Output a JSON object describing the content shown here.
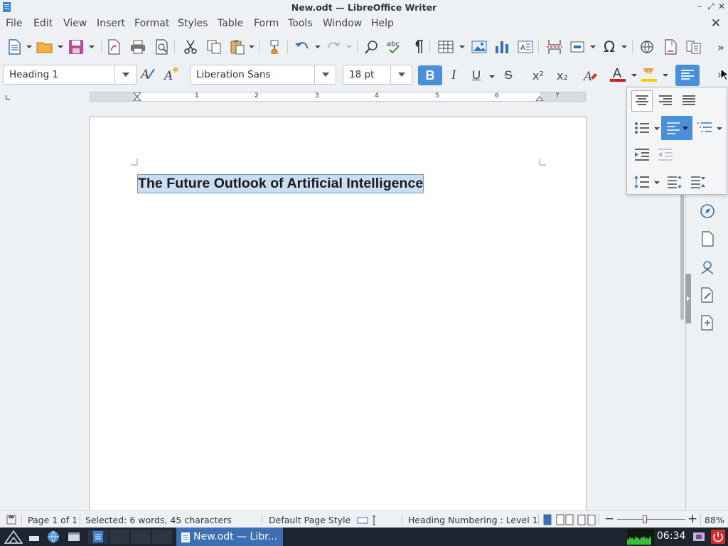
{
  "window": {
    "title": "New.odt — LibreOffice Writer",
    "minimize": "–",
    "maximize": "⤢",
    "close": "✕"
  },
  "menubar": {
    "items": [
      "File",
      "Edit",
      "View",
      "Insert",
      "Format",
      "Styles",
      "Table",
      "Form",
      "Tools",
      "Window",
      "Help"
    ],
    "close": "✕"
  },
  "toolbar": {
    "paragraph_style": "Heading 1",
    "font_name": "Liberation Sans",
    "font_size": "18 pt",
    "bold": "B",
    "italic": "I",
    "underline": "U",
    "strikethrough": "S",
    "superscript": "x²",
    "subscript": "x₂",
    "more": "»"
  },
  "document": {
    "heading": "The Future Outlook of Artificial Intelligence"
  },
  "ruler": {
    "numbers": [
      "1",
      "2",
      "3",
      "4",
      "5",
      "6",
      "7"
    ]
  },
  "statusbar": {
    "page": "Page 1 of 1",
    "selection": "Selected: 6 words, 45 characters",
    "page_style": "Default Page Style",
    "outline": "Heading Numbering : Level 1",
    "zoom": "88%",
    "zoom_minus": "−",
    "zoom_plus": "+"
  },
  "taskbar": {
    "task_label": "New.odt — Libr...",
    "clock": "06:34"
  },
  "colors": {
    "accent": "#4a90d9",
    "selection": "#c9ddf3",
    "taskbar": "#1e2530",
    "font_color": "#d02020",
    "highlight": "#f5d000"
  }
}
